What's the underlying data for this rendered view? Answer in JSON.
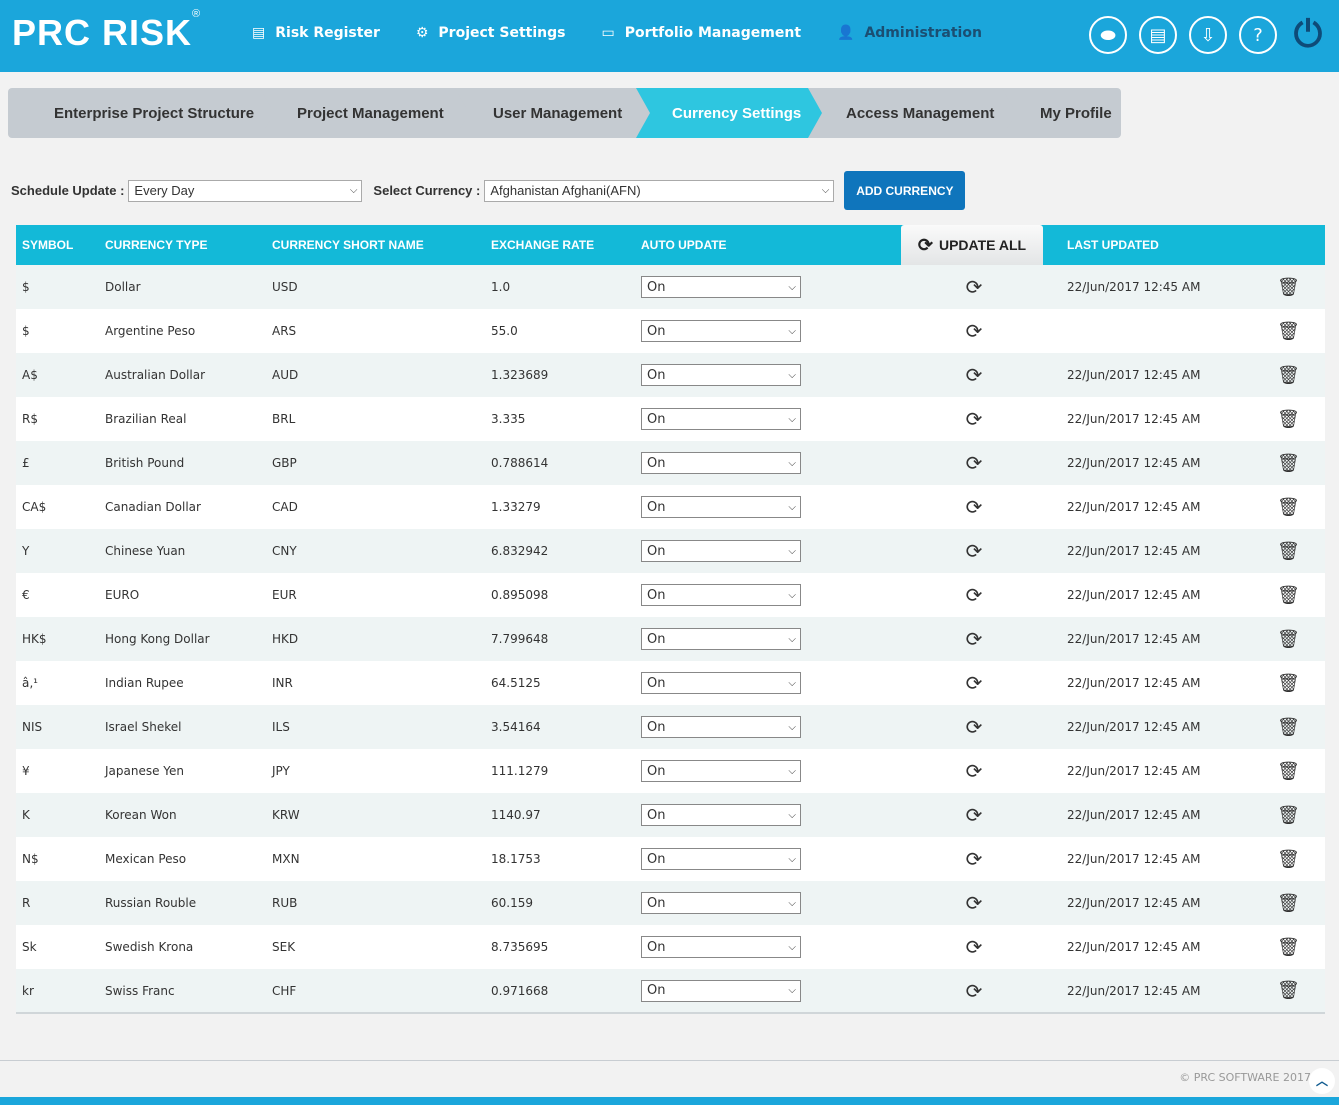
{
  "app": {
    "logo": "PRC RISK",
    "registered": "®"
  },
  "nav": [
    {
      "label": "Risk Register",
      "icon": "list-icon"
    },
    {
      "label": "Project Settings",
      "icon": "settings-monitor-icon"
    },
    {
      "label": "Portfolio Management",
      "icon": "folder-icon"
    },
    {
      "label": "Administration",
      "icon": "user-icon"
    }
  ],
  "tools": [
    {
      "icon": "toggle-icon",
      "glyph": "⬬"
    },
    {
      "icon": "calendar-download-icon",
      "glyph": "▤"
    },
    {
      "icon": "inbox-download-icon",
      "glyph": "⇩"
    },
    {
      "icon": "help-icon",
      "glyph": "?"
    },
    {
      "icon": "power-icon",
      "glyph": "⏻"
    }
  ],
  "tabs": [
    {
      "label": "Enterprise Project Structure"
    },
    {
      "label": "Project Management"
    },
    {
      "label": "User Management"
    },
    {
      "label": "Currency Settings",
      "active": true
    },
    {
      "label": "Access Management"
    },
    {
      "label": "My Profile"
    }
  ],
  "filters": {
    "schedule_label": "Schedule Update :",
    "schedule_value": "Every Day",
    "currency_label": "Select Currency :",
    "currency_value": "Afghanistan Afghani(AFN)",
    "add_button": "ADD CURRENCY"
  },
  "table": {
    "headers": {
      "symbol": "SYMBOL",
      "type": "CURRENCY TYPE",
      "short": "CURRENCY SHORT NAME",
      "rate": "EXCHANGE RATE",
      "auto": "AUTO UPDATE",
      "update_all": "UPDATE ALL",
      "last": "LAST UPDATED"
    },
    "rows": [
      [
        "$",
        "Dollar",
        "USD",
        "1.0",
        "On",
        "22/Jun/2017 12:45 AM"
      ],
      [
        "$",
        "Argentine Peso",
        "ARS",
        "55.0",
        "On",
        ""
      ],
      [
        "A$",
        "Australian Dollar",
        "AUD",
        "1.323689",
        "On",
        "22/Jun/2017 12:45 AM"
      ],
      [
        "R$",
        "Brazilian Real",
        "BRL",
        "3.335",
        "On",
        "22/Jun/2017 12:45 AM"
      ],
      [
        "£",
        "British Pound",
        "GBP",
        "0.788614",
        "On",
        "22/Jun/2017 12:45 AM"
      ],
      [
        "CA$",
        "Canadian Dollar",
        "CAD",
        "1.33279",
        "On",
        "22/Jun/2017 12:45 AM"
      ],
      [
        "Y",
        "Chinese Yuan",
        "CNY",
        "6.832942",
        "On",
        "22/Jun/2017 12:45 AM"
      ],
      [
        "€",
        "EURO",
        "EUR",
        "0.895098",
        "On",
        "22/Jun/2017 12:45 AM"
      ],
      [
        "HK$",
        "Hong Kong Dollar",
        "HKD",
        "7.799648",
        "On",
        "22/Jun/2017 12:45 AM"
      ],
      [
        "â‚¹",
        "Indian Rupee",
        "INR",
        "64.5125",
        "On",
        "22/Jun/2017 12:45 AM"
      ],
      [
        "NIS",
        "Israel Shekel",
        "ILS",
        "3.54164",
        "On",
        "22/Jun/2017 12:45 AM"
      ],
      [
        "¥",
        "Japanese Yen",
        "JPY",
        "111.1279",
        "On",
        "22/Jun/2017 12:45 AM"
      ],
      [
        "K",
        "Korean Won",
        "KRW",
        "1140.97",
        "On",
        "22/Jun/2017 12:45 AM"
      ],
      [
        "N$",
        "Mexican Peso",
        "MXN",
        "18.1753",
        "On",
        "22/Jun/2017 12:45 AM"
      ],
      [
        "R",
        "Russian Rouble",
        "RUB",
        "60.159",
        "On",
        "22/Jun/2017 12:45 AM"
      ],
      [
        "Sk",
        "Swedish Krona",
        "SEK",
        "8.735695",
        "On",
        "22/Jun/2017 12:45 AM"
      ],
      [
        "kr",
        "Swiss Franc",
        "CHF",
        "0.971668",
        "On",
        "22/Jun/2017 12:45 AM"
      ]
    ]
  },
  "footer": {
    "copyright": "© PRC SOFTWARE 2017"
  },
  "colors": {
    "header": "#1ba6db",
    "table_header": "#13b9d8",
    "active_tab": "#2ec6e0",
    "button": "#0f75bc"
  }
}
